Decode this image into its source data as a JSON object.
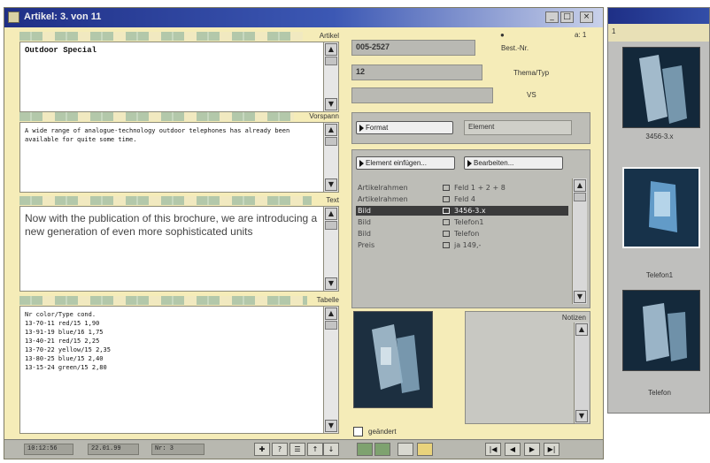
{
  "window": {
    "title": "Artikel: 3. von 11",
    "controls": [
      "_",
      "□",
      "×"
    ]
  },
  "fields": {
    "artikel": {
      "label": "Artikel",
      "value": "Outdoor Special"
    },
    "vorspann": {
      "label": "Vorspann",
      "value": "A wide range of analogue-technology outdoor telephones has already been available for quite some time."
    },
    "text": {
      "label": "Text",
      "value": "Now with the publication of this brochure, we are introducing a new generation of even more sophisticated units"
    },
    "tabelle": {
      "label": "Tabelle",
      "lines": [
        "Nr color/Type cond.",
        "13-70-11 red/15 1,90",
        "13-91-19 blue/16 1,75",
        "13-40-21 red/15 2,25",
        "13-70-22 yellow/15 2,35",
        "13-80-25 blue/15 2,40",
        "13-15-24 green/15 2,80"
      ]
    }
  },
  "right": {
    "top_marker": "● ",
    "top_marker_right": "a: 1",
    "best_nr": {
      "label": "Best.-Nr.",
      "value": "005-2527"
    },
    "thema": {
      "label": "Thema/Typ",
      "value": "12"
    },
    "seite": {
      "label": "VS",
      "value": ""
    },
    "format_button": "Format",
    "format_value": "Element",
    "element_button": "Element einfügen...",
    "bearbeiten_button": "Bearbeiten...",
    "elements": [
      {
        "name": "Artikelrahmen",
        "value": "Feld 1 + 2 + 8",
        "selected": false
      },
      {
        "name": "Artikelrahmen",
        "value": "Feld 4",
        "selected": false
      },
      {
        "name": "Bild",
        "value": "3456-3.x",
        "selected": true
      },
      {
        "name": "Bild",
        "value": "Telefon1",
        "selected": false
      },
      {
        "name": "Bild",
        "value": "Telefon",
        "selected": false
      },
      {
        "name": "Preis",
        "value": "ja 149,-",
        "selected": false
      }
    ],
    "notizen_label": "Notizen",
    "geaendert_label": "geändert"
  },
  "status": {
    "time": "10:12:56",
    "date": "22.01.99",
    "record": "Nr: 3",
    "tools": [
      "✚",
      "?",
      "☰",
      "↑",
      "↓"
    ],
    "nav": [
      "|◀",
      "◀",
      "▶",
      "▶|"
    ]
  },
  "sidebar": {
    "top_label": "1",
    "thumbnails": [
      {
        "label": "3456-3.x"
      },
      {
        "label": "Telefon1"
      },
      {
        "label": "Telefon"
      }
    ]
  }
}
